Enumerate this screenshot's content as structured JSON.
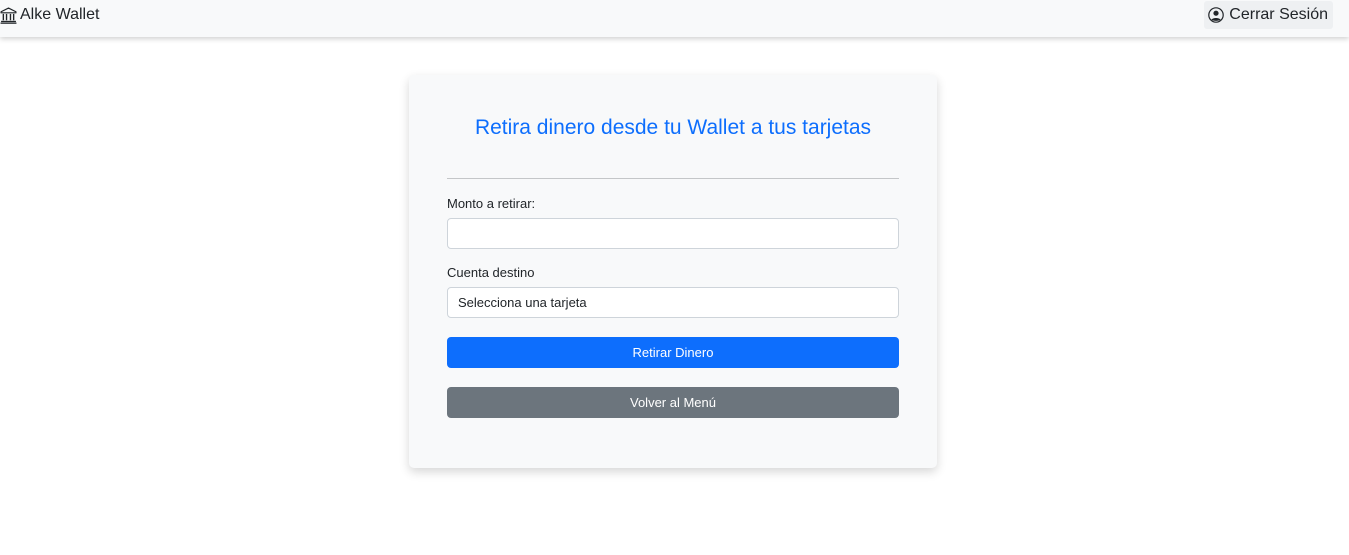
{
  "navbar": {
    "brand_label": "Alke Wallet",
    "brand_icon": "bank-icon",
    "logout_label": "Cerrar Sesión",
    "logout_icon": "user-circle-icon"
  },
  "card": {
    "title": "Retira dinero desde tu Wallet a tus tarjetas",
    "amount_label": "Monto a retirar:",
    "amount_value": "",
    "account_label": "Cuenta destino",
    "account_selected": "Selecciona una tarjeta",
    "withdraw_button": "Retirar Dinero",
    "back_button": "Volver al Menú"
  },
  "colors": {
    "primary": "#0d6efd",
    "secondary": "#6c757d",
    "navbar_bg": "#f8f9fa",
    "card_bg": "#f8f9fa"
  }
}
